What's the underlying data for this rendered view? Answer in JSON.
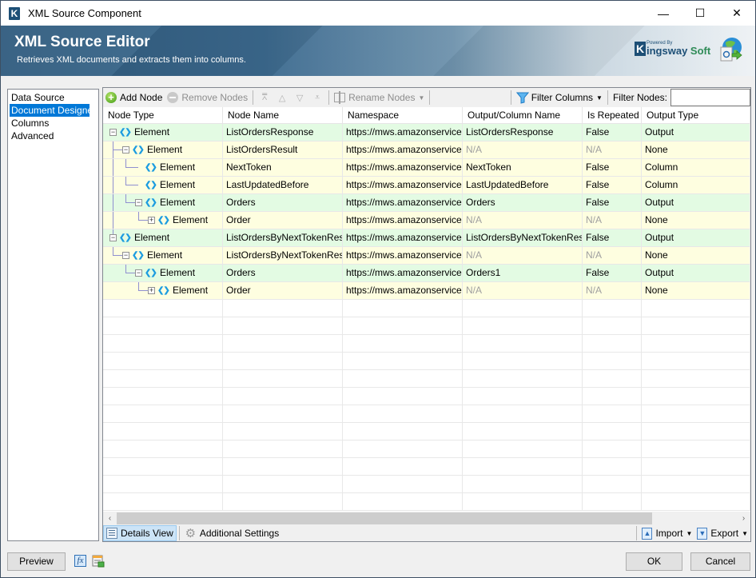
{
  "window": {
    "title": "XML Source Component",
    "controls": {
      "minimize": "—",
      "maximize": "☐",
      "close": "✕"
    }
  },
  "banner": {
    "title": "XML Source Editor",
    "subtitle": "Retrieves XML documents and extracts them into columns.",
    "brand_powered": "Powered By",
    "brand_k": "K",
    "brand_name": "ingsway",
    "brand_soft": "Soft"
  },
  "nav": {
    "items": [
      {
        "label": "Data Source",
        "selected": false
      },
      {
        "label": "Document Designer",
        "selected": true
      },
      {
        "label": "Columns",
        "selected": false
      },
      {
        "label": "Advanced",
        "selected": false
      }
    ]
  },
  "toolbar": {
    "add_node": "Add Node",
    "remove_nodes": "Remove Nodes",
    "move_top": "⩞",
    "move_up": "△",
    "move_down": "▽",
    "move_bottom": "⩡",
    "rename_nodes": "Rename Nodes",
    "filter_columns": "Filter Columns",
    "filter_nodes_label": "Filter Nodes:",
    "filter_nodes_value": ""
  },
  "grid": {
    "columns": [
      "Node Type",
      "Node Name",
      "Namespace",
      "Output/Column Name",
      "Is Repeated",
      "Output Type"
    ],
    "rows": [
      {
        "level": 0,
        "expander": "minus",
        "type": "Element",
        "name": "ListOrdersResponse",
        "namespace": "https://mws.amazonservice...",
        "output": "ListOrdersResponse",
        "repeated": "False",
        "output_type": "Output",
        "color": "green"
      },
      {
        "level": 1,
        "expander": "minus",
        "type": "Element",
        "name": "ListOrdersResult",
        "namespace": "https://mws.amazonservice...",
        "output": "N/A",
        "repeated": "N/A",
        "output_type": "None",
        "color": "yellow"
      },
      {
        "level": 2,
        "expander": "none",
        "type": "Element",
        "name": "NextToken",
        "namespace": "https://mws.amazonservice...",
        "output": "NextToken",
        "repeated": "False",
        "output_type": "Column",
        "color": "yellow"
      },
      {
        "level": 2,
        "expander": "none",
        "type": "Element",
        "name": "LastUpdatedBefore",
        "namespace": "https://mws.amazonservice...",
        "output": "LastUpdatedBefore",
        "repeated": "False",
        "output_type": "Column",
        "color": "yellow"
      },
      {
        "level": 2,
        "expander": "minus",
        "type": "Element",
        "name": "Orders",
        "namespace": "https://mws.amazonservice...",
        "output": "Orders",
        "repeated": "False",
        "output_type": "Output",
        "color": "green"
      },
      {
        "level": 3,
        "expander": "plus",
        "type": "Element",
        "name": "Order",
        "namespace": "https://mws.amazonservice...",
        "output": "N/A",
        "repeated": "N/A",
        "output_type": "None",
        "color": "yellow"
      },
      {
        "level": 0,
        "expander": "minus",
        "type": "Element",
        "name": "ListOrdersByNextTokenRes...",
        "namespace": "https://mws.amazonservice...",
        "output": "ListOrdersByNextTokenRes...",
        "repeated": "False",
        "output_type": "Output",
        "color": "green"
      },
      {
        "level": 1,
        "expander": "minus",
        "type": "Element",
        "name": "ListOrdersByNextTokenResult",
        "namespace": "https://mws.amazonservice...",
        "output": "N/A",
        "repeated": "N/A",
        "output_type": "None",
        "color": "yellow"
      },
      {
        "level": 2,
        "expander": "minus",
        "type": "Element",
        "name": "Orders",
        "namespace": "https://mws.amazonservice...",
        "output": "Orders1",
        "repeated": "False",
        "output_type": "Output",
        "color": "green"
      },
      {
        "level": 3,
        "expander": "plus",
        "type": "Element",
        "name": "Order",
        "namespace": "https://mws.amazonservice...",
        "output": "N/A",
        "repeated": "N/A",
        "output_type": "None",
        "color": "yellow"
      }
    ],
    "empty_rows": 12
  },
  "scrollbar": {
    "left": "‹",
    "right": "›"
  },
  "bottombar": {
    "details_view": "Details View",
    "additional_settings": "Additional Settings",
    "import": "Import",
    "export": "Export"
  },
  "footer": {
    "preview": "Preview",
    "fx": "fx",
    "ok": "OK",
    "cancel": "Cancel"
  }
}
